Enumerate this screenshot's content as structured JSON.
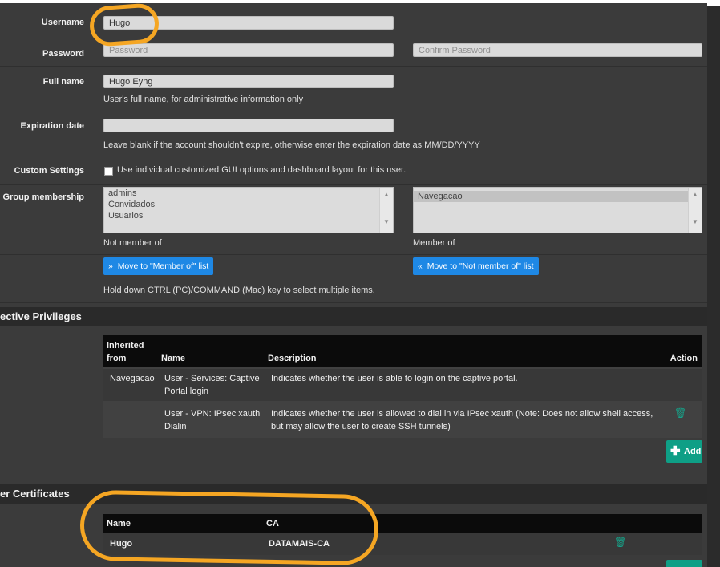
{
  "username": {
    "label": "Username",
    "value": "Hugo"
  },
  "password": {
    "label": "Password",
    "placeholder": "Password",
    "confirm_placeholder": "Confirm Password"
  },
  "fullname": {
    "label": "Full name",
    "value": "Hugo Eyng",
    "help": "User's full name, for administrative information only"
  },
  "expiration": {
    "label": "Expiration date",
    "value": "",
    "help": "Leave blank if the account shouldn't expire, otherwise enter the expiration date as MM/DD/YYYY"
  },
  "custom_settings": {
    "label": "Custom Settings",
    "checkbox_label": "Use individual customized GUI options and dashboard layout for this user.",
    "checked": false
  },
  "group_membership": {
    "label": "Group membership",
    "not_member_of": [
      "admins",
      "Convidados",
      "Usuarios"
    ],
    "member_of": [
      "Navegacao"
    ],
    "not_member_label": "Not member of",
    "member_label": "Member of",
    "move_to_member_label": "Move to \"Member of\" list",
    "move_to_not_member_label": "Move to \"Not member of\" list",
    "help": "Hold down CTRL (PC)/COMMAND (Mac) key to select multiple items."
  },
  "effective_privileges": {
    "title": "ective Privileges",
    "headers": {
      "inherited_from": "Inherited from",
      "inherited_1": "Inherited",
      "inherited_2": "from",
      "name": "Name",
      "description": "Description",
      "action": "Action"
    },
    "rows": [
      {
        "inherited_from": "Navegacao",
        "name_1": "User - Services: Captive",
        "name_2": "Portal login",
        "desc_1": "Indicates whether the user is able to login on the captive portal.",
        "desc_2": ""
      },
      {
        "inherited_from": "",
        "name_1": "User - VPN: IPsec xauth",
        "name_2": "Dialin",
        "desc_1": "Indicates whether the user is allowed to dial in via IPsec xauth (Note: Does not allow shell access,",
        "desc_2": "but may allow the user to create SSH tunnels)"
      }
    ],
    "add_label": "Add"
  },
  "user_certificates": {
    "title": "er Certificates",
    "headers": {
      "name": "Name",
      "ca": "CA"
    },
    "rows": [
      {
        "name": "Hugo",
        "ca": "DATAMAIS-CA"
      }
    ]
  },
  "colors": {
    "highlight": "#f5a623",
    "accent_blue": "#1e88e5",
    "accent_green": "#0e9f86"
  },
  "icons": {
    "trash": "trash-icon",
    "plus": "plus-icon",
    "double_chevron_right": "double-chevron-right-icon",
    "double_chevron_left": "double-chevron-left-icon"
  }
}
